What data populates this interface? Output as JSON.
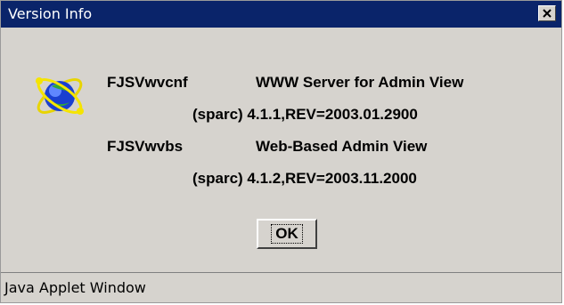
{
  "window": {
    "title": "Version Info",
    "close_symbol": "×"
  },
  "packages": [
    {
      "name": "FJSVwvcnf",
      "description": "WWW Server for Admin View",
      "version": "(sparc) 4.1.1,REV=2003.01.2900"
    },
    {
      "name": "FJSVwvbs",
      "description": "Web-Based Admin View",
      "version": "(sparc) 4.1.2,REV=2003.11.2000"
    }
  ],
  "buttons": {
    "ok_label": "OK"
  },
  "statusbar": {
    "text": "Java Applet Window"
  },
  "icons": {
    "logo": "globe-orbit-icon",
    "close": "close-icon"
  },
  "colors": {
    "titlebar": "#0a246a",
    "window_bg": "#d6d3ce"
  }
}
